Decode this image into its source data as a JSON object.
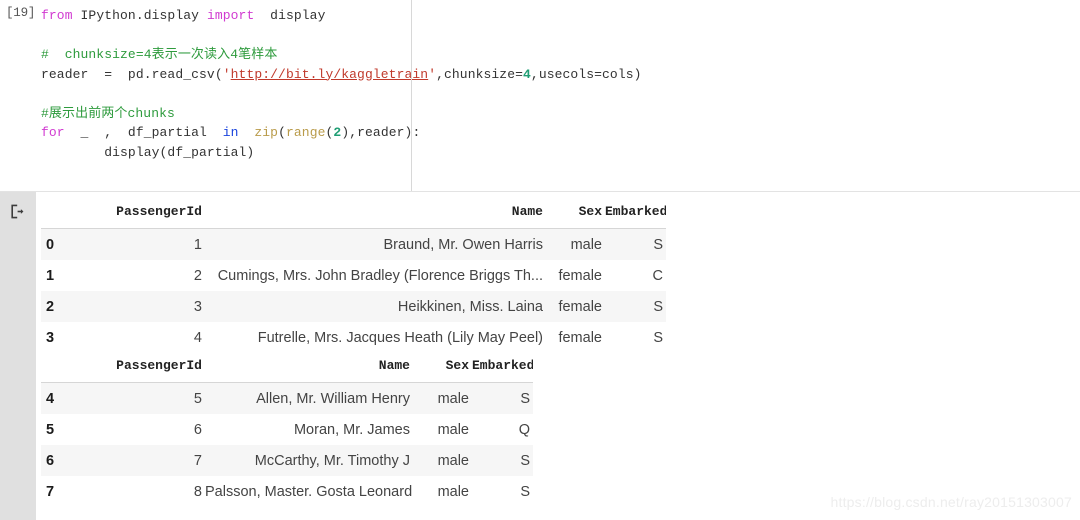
{
  "notebook": {
    "exec_prompt": "[19]",
    "output_icon_name": "output-arrow-icon",
    "code_lines": [
      [
        {
          "t": "from",
          "c": "kw"
        },
        {
          "t": " IPython.display ",
          "c": "pln"
        },
        {
          "t": "import",
          "c": "kw"
        },
        {
          "t": "  display",
          "c": "pln"
        }
      ],
      [],
      [
        {
          "t": "#  chunksize=4表示一次读入4笔样本",
          "c": "cmt"
        }
      ],
      [
        {
          "t": "reader  =  pd.read_csv(",
          "c": "pln"
        },
        {
          "t": "'",
          "c": "str"
        },
        {
          "t": "http://bit.ly/kaggletrain",
          "c": "url"
        },
        {
          "t": "'",
          "c": "str"
        },
        {
          "t": ",chunksize=",
          "c": "pln"
        },
        {
          "t": "4",
          "c": "num"
        },
        {
          "t": ",usecols=cols)",
          "c": "pln"
        }
      ],
      [],
      [
        {
          "t": "#展示出前两个chunks",
          "c": "cmt"
        }
      ],
      [
        {
          "t": "for",
          "c": "kw"
        },
        {
          "t": "  _  ,  df_partial  ",
          "c": "pln"
        },
        {
          "t": "in",
          "c": "kw2"
        },
        {
          "t": "  ",
          "c": "pln"
        },
        {
          "t": "zip",
          "c": "bltn"
        },
        {
          "t": "(",
          "c": "pln"
        },
        {
          "t": "range",
          "c": "bltn"
        },
        {
          "t": "(",
          "c": "pln"
        },
        {
          "t": "2",
          "c": "num"
        },
        {
          "t": "),reader):",
          "c": "pln"
        }
      ],
      [
        {
          "t": "        display(df_partial)",
          "c": "pln"
        }
      ]
    ]
  },
  "tables": [
    {
      "name": "dataframe-chunk-1",
      "columns": [
        "",
        "PassengerId",
        "Name",
        "Sex",
        "Embarked"
      ],
      "rows": [
        {
          "index": "0",
          "PassengerId": "1",
          "Name": "Braund, Mr. Owen Harris",
          "Sex": "male",
          "Embarked": "S"
        },
        {
          "index": "1",
          "PassengerId": "2",
          "Name": "Cumings, Mrs. John Bradley (Florence Briggs Th...",
          "Sex": "female",
          "Embarked": "C"
        },
        {
          "index": "2",
          "PassengerId": "3",
          "Name": "Heikkinen, Miss. Laina",
          "Sex": "female",
          "Embarked": "S"
        },
        {
          "index": "3",
          "PassengerId": "4",
          "Name": "Futrelle, Mrs. Jacques Heath (Lily May Peel)",
          "Sex": "female",
          "Embarked": "S"
        }
      ]
    },
    {
      "name": "dataframe-chunk-2",
      "columns": [
        "",
        "PassengerId",
        "Name",
        "Sex",
        "Embarked"
      ],
      "rows": [
        {
          "index": "4",
          "PassengerId": "5",
          "Name": "Allen, Mr. William Henry",
          "Sex": "male",
          "Embarked": "S"
        },
        {
          "index": "5",
          "PassengerId": "6",
          "Name": "Moran, Mr. James",
          "Sex": "male",
          "Embarked": "Q"
        },
        {
          "index": "6",
          "PassengerId": "7",
          "Name": "McCarthy, Mr. Timothy J",
          "Sex": "male",
          "Embarked": "S"
        },
        {
          "index": "7",
          "PassengerId": "8",
          "Name": "Palsson, Master. Gosta Leonard",
          "Sex": "male",
          "Embarked": "S"
        }
      ]
    }
  ],
  "watermark": {
    "text": "https://blog.csdn.net/ray20151303007"
  },
  "colors": {
    "keyword": "#d13bd1",
    "keyword_in": "#1a44dd",
    "builtin": "#b99b4a",
    "number": "#1f9e74",
    "string": "#c0392b",
    "comment": "#2e9b3d",
    "gutter": "#e0e0e0",
    "row_stripe": "#f6f6f6"
  }
}
